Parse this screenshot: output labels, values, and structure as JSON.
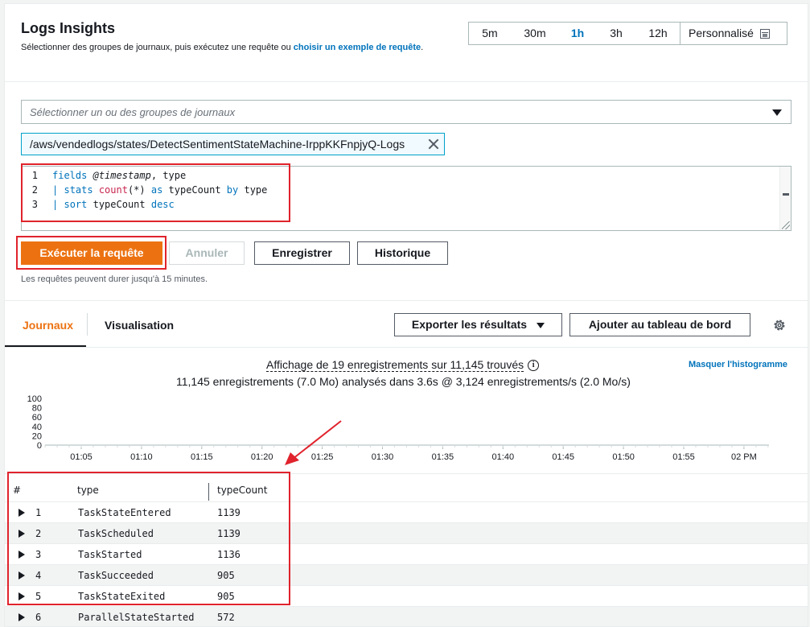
{
  "header": {
    "title": "Logs Insights",
    "description_prefix": "Sélectionner des groupes de journaux, puis exécutez une requête ou ",
    "description_link": "choisir un exemple de requête",
    "description_suffix": "."
  },
  "time_range": {
    "options": [
      "5m",
      "30m",
      "1h",
      "3h",
      "12h"
    ],
    "selected": "1h",
    "custom_label": "Personnalisé"
  },
  "log_group_select": {
    "placeholder": "Sélectionner un ou des groupes de journaux"
  },
  "selected_group": "/aws/vendedlogs/states/DetectSentimentStateMachine-IrppKKFnpjyQ-Logs",
  "query": {
    "line_numbers": [
      "1",
      "2",
      "3"
    ]
  },
  "buttons": {
    "run": "Exécuter la requête",
    "cancel": "Annuler",
    "save": "Enregistrer",
    "history": "Historique",
    "export": "Exporter les résultats",
    "add_dashboard": "Ajouter au tableau de bord"
  },
  "hint": "Les requêtes peuvent durer jusqu'à 15 minutes.",
  "tabs": {
    "logs": "Journaux",
    "visualization": "Visualisation"
  },
  "stats": {
    "shown": "Affichage de 19 enregistrements sur 11,145 trouvés",
    "scanned": "11,145 enregistrements (7.0 Mo) analysés dans 3.6s @ 3,124 enregistrements/s (2.0 Mo/s)",
    "hide_histogram": "Masquer l'histogramme"
  },
  "chart_data": {
    "type": "bar",
    "y_ticks": [
      "100",
      "80",
      "60",
      "40",
      "20",
      "0"
    ],
    "ylim": [
      0,
      100
    ],
    "x_ticks": [
      "01:05",
      "01:10",
      "01:15",
      "01:20",
      "01:25",
      "01:30",
      "01:35",
      "01:40",
      "01:45",
      "01:50",
      "01:55",
      "02 PM"
    ],
    "values": []
  },
  "table": {
    "headers": [
      "#",
      "type",
      "typeCount"
    ],
    "rows": [
      {
        "n": "1",
        "type": "TaskStateEntered",
        "count": "1139"
      },
      {
        "n": "2",
        "type": "TaskScheduled",
        "count": "1139"
      },
      {
        "n": "3",
        "type": "TaskStarted",
        "count": "1136"
      },
      {
        "n": "4",
        "type": "TaskSucceeded",
        "count": "905"
      },
      {
        "n": "5",
        "type": "TaskStateExited",
        "count": "905"
      },
      {
        "n": "6",
        "type": "ParallelStateStarted",
        "count": "572"
      }
    ]
  },
  "colors": {
    "primary": "#ec7211",
    "link": "#0073bb",
    "annotation": "#e0232c"
  }
}
